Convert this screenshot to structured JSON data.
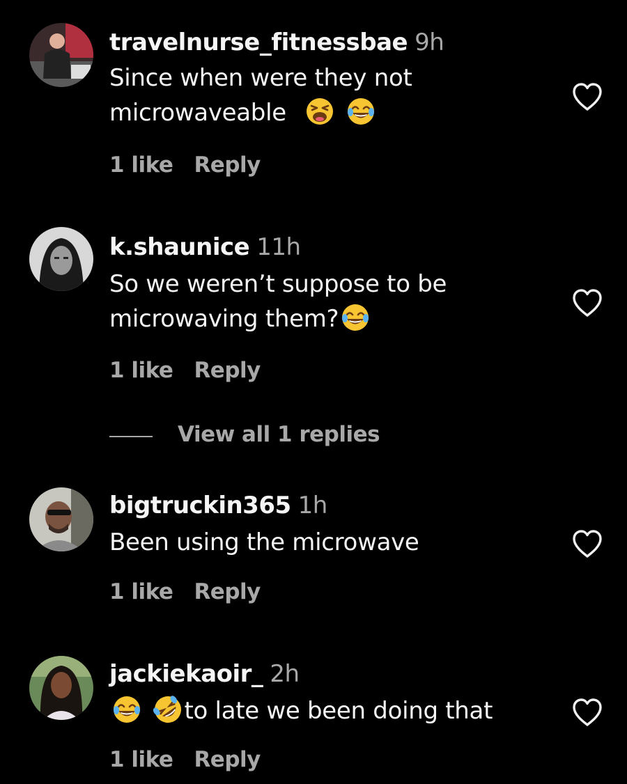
{
  "comments": [
    {
      "username": "travelnurse_fitnessbae",
      "time": "9h",
      "text_line1": "Since when were they not",
      "text_line2": "microwaveable",
      "likes": "1 like",
      "reply": "Reply"
    },
    {
      "username": "k.shaunice",
      "time": "11h",
      "text_line1": "So we weren’t suppose to be",
      "text_line2": "microwaving them?",
      "likes": "1 like",
      "reply": "Reply",
      "view_replies": "View all 1 replies"
    },
    {
      "username": "bigtruckin365",
      "time": "1h",
      "text_line1": "Been using the microwave",
      "likes": "1 like",
      "reply": "Reply"
    },
    {
      "username": "jackiekaoir_",
      "time": "2h",
      "text_line1": "to late we been doing that",
      "likes": "1 like",
      "reply": "Reply"
    }
  ],
  "colors": {
    "background": "#000000",
    "primary_text": "#f5f5f5",
    "secondary_text": "#a8a8a8"
  },
  "icons": [
    "heart-icon",
    "weary-face-emoji",
    "joy-emoji",
    "rofl-emoji"
  ]
}
